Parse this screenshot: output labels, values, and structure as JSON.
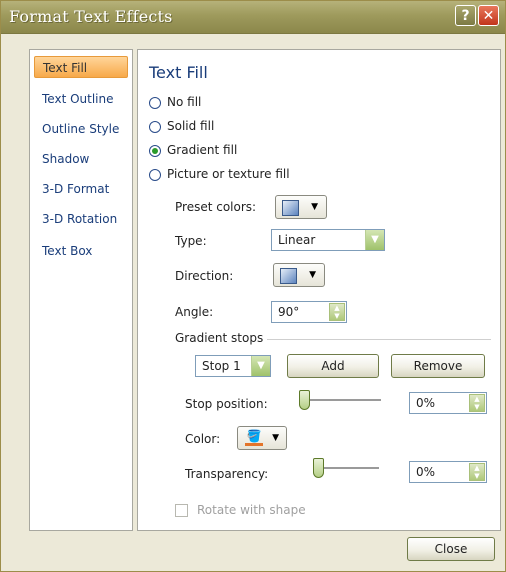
{
  "window": {
    "title": "Format Text Effects"
  },
  "sidebar": {
    "items": [
      {
        "label": "Text Fill",
        "active": true
      },
      {
        "label": "Text Outline"
      },
      {
        "label": "Outline Style"
      },
      {
        "label": "Shadow"
      },
      {
        "label": "3-D Format"
      },
      {
        "label": "3-D Rotation"
      },
      {
        "label": "Text Box"
      }
    ]
  },
  "panel": {
    "heading": "Text Fill",
    "fill_options": [
      "No fill",
      "Solid fill",
      "Gradient fill",
      "Picture or texture fill"
    ],
    "selected_fill": "Gradient fill",
    "preset_colors_label": "Preset colors:",
    "type_label": "Type:",
    "type_value": "Linear",
    "direction_label": "Direction:",
    "angle_label": "Angle:",
    "angle_value": "90°",
    "gradient_stops_label": "Gradient stops",
    "stop_value": "Stop 1",
    "add_label": "Add",
    "remove_label": "Remove",
    "stop_position_label": "Stop position:",
    "stop_position_value": "0%",
    "stop_position_level": 0,
    "color_label": "Color:",
    "transparency_label": "Transparency:",
    "transparency_value": "0%",
    "transparency_level": 0,
    "rotate_label": "Rotate with shape",
    "rotate_checked": false
  },
  "footer": {
    "close_label": "Close"
  },
  "colors": {
    "titlebar": "#9e9a5c",
    "active_tab": "#f7a94a",
    "heading": "#1a3d7a",
    "close_x": "#c2351b"
  },
  "icons": {
    "help": "question-mark",
    "close": "x-mark",
    "dropdown": "triangle-down",
    "paint-bucket": "paint-bucket"
  }
}
